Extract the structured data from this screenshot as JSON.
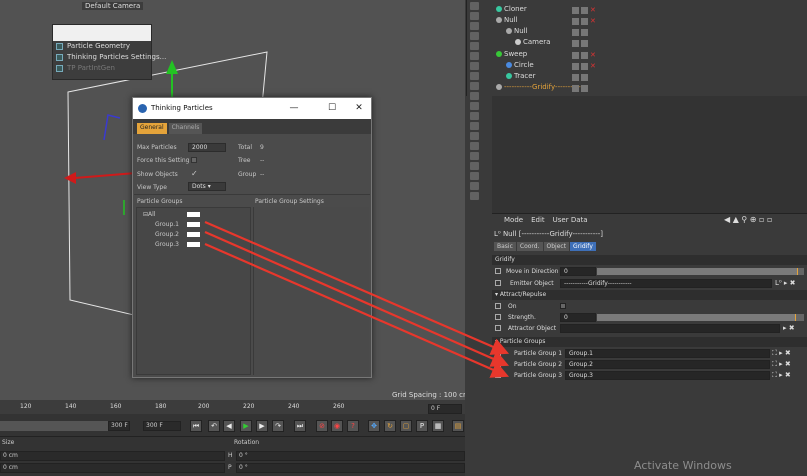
{
  "viewport": {
    "camera_label": "Default Camera",
    "grid_spacing": "Grid Spacing : 100 cm"
  },
  "context_menu": {
    "items": [
      "Particle Geometry",
      "Thinking Particles Settings...",
      "TP PartIntGen"
    ]
  },
  "tp_window": {
    "title": "Thinking Particles",
    "controls": {
      "minimize": "—",
      "maximize": "☐",
      "close": "✕"
    },
    "tabs": [
      "General",
      "Channels"
    ],
    "max_particles_label": "Max Particles",
    "max_particles_value": "2000",
    "total_label": "Total",
    "total_value": "9",
    "force_label": "Force this Setting",
    "tree_label": "Tree",
    "tree_value": "--",
    "show_objects_label": "Show Objects",
    "group_label": "Group",
    "group_value": "--",
    "view_type_label": "View Type",
    "view_type_value": "Dots",
    "particle_groups_header": "Particle Groups",
    "group_settings_header": "Particle Group Settings",
    "tree": {
      "all": "All",
      "groups": [
        "Group.1",
        "Group.2",
        "Group.3"
      ]
    }
  },
  "object_manager": {
    "objects": [
      "Cloner",
      "Null",
      "Null",
      "Camera",
      "Sweep",
      "Circle",
      "Tracer",
      "-----------Gridify-----------"
    ]
  },
  "attributes": {
    "menu": [
      "Mode",
      "Edit",
      "User Data"
    ],
    "object_line": "Null [-----------Gridify-----------]",
    "tabs": [
      "Basic",
      "Coord.",
      "Object",
      "Gridify"
    ],
    "active_tab": "Gridify",
    "section_gridify": "Gridify",
    "move_in_direction_label": "Move in Direction",
    "move_in_direction_value": "0",
    "move_in_direction_fraction": 0.97,
    "emitter_object_label": "Emitter Object",
    "emitter_object_value": "-----------Gridify-----------",
    "section_attract": "Attract/Repulse",
    "on_label": "On",
    "strength_label": "Strength.",
    "strength_value": "0",
    "strength_fraction": 0.96,
    "attractor_label": "Attractor Object",
    "section_groups": "Particle Groups",
    "groups": [
      {
        "label": "Particle Group 1",
        "value": "Group.1"
      },
      {
        "label": "Particle Group 2",
        "value": "Group.2"
      },
      {
        "label": "Particle Group 3",
        "value": "Group.3"
      }
    ]
  },
  "timeline": {
    "ticks": [
      "120",
      "140",
      "160",
      "180",
      "200",
      "220",
      "240",
      "260"
    ],
    "current_frame": "0 F",
    "end_field": "300 F",
    "end_field2": "300 F",
    "size_header": "Size",
    "rotation_header": "Rotation",
    "rows": [
      {
        "size": "0 cm",
        "axis": "H",
        "rot": "0 °"
      },
      {
        "size": "0 cm",
        "axis": "P",
        "rot": "0 °"
      }
    ]
  },
  "watermark": "Activate Windows",
  "colors": {
    "accent": "#e4a33a",
    "arrow": "#e8372c",
    "tab_active": "#3e6fb7"
  }
}
